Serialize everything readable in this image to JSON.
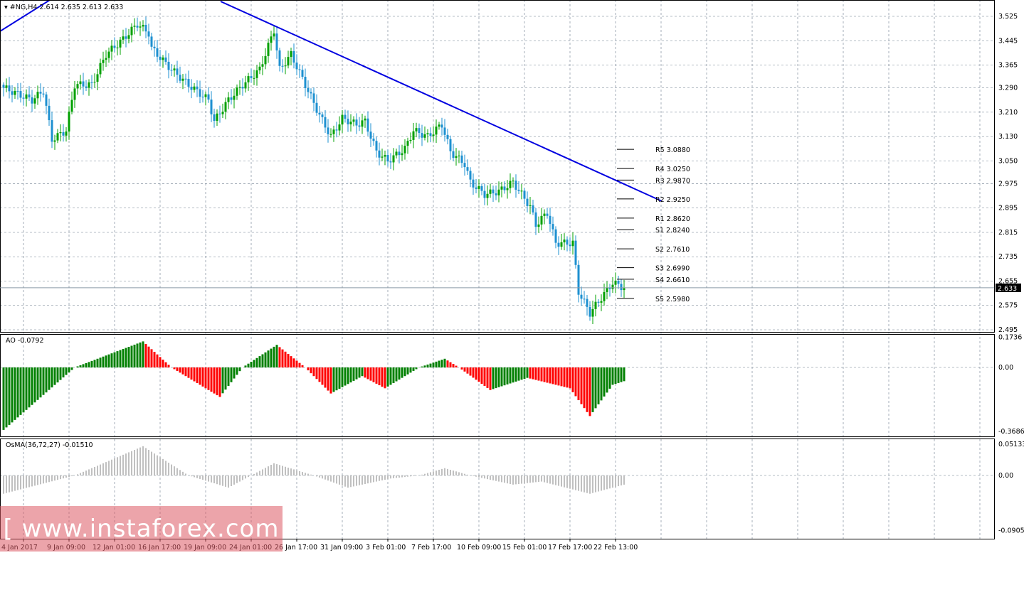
{
  "header": {
    "symbol": "#NG,H4",
    "ohlc": "2.614 2.635 2.613 2.633"
  },
  "watermark": "[ www.instaforex.com ]",
  "colors": {
    "up": "#00a000",
    "down": "#1e90d0",
    "trend": "#0000e0",
    "ao_up": "#008000",
    "ao_down": "#ff0000",
    "osma": "#c0c0c0",
    "grid": "#6a7a8a"
  },
  "chart_data": [
    {
      "type": "candlestick",
      "title": "#NG,H4",
      "last_price": "2.633",
      "yticks": [
        "3.525",
        "3.445",
        "3.365",
        "3.290",
        "3.210",
        "3.130",
        "3.050",
        "2.975",
        "2.895",
        "2.815",
        "2.735",
        "2.655",
        "2.575",
        "2.495"
      ],
      "ylim": [
        2.495,
        3.525
      ],
      "xticks": [
        "4 Jan 2017",
        "9 Jan 09:00",
        "12 Jan 01:00",
        "16 Jan 17:00",
        "19 Jan 09:00",
        "24 Jan 01:00",
        "26 Jan 17:00",
        "31 Jan 09:00",
        "3 Feb 01:00",
        "7 Feb 17:00",
        "10 Feb 09:00",
        "15 Feb 01:00",
        "17 Feb 17:00",
        "22 Feb 13:00"
      ],
      "close_keypoints": [
        [
          0,
          3.29
        ],
        [
          10,
          3.25
        ],
        [
          14,
          3.28
        ],
        [
          17,
          3.12
        ],
        [
          22,
          3.15
        ],
        [
          25,
          3.3
        ],
        [
          31,
          3.3
        ],
        [
          36,
          3.4
        ],
        [
          42,
          3.45
        ],
        [
          47,
          3.5
        ],
        [
          51,
          3.47
        ],
        [
          52,
          3.42
        ],
        [
          59,
          3.35
        ],
        [
          65,
          3.3
        ],
        [
          72,
          3.25
        ],
        [
          74,
          3.18
        ],
        [
          79,
          3.25
        ],
        [
          84,
          3.3
        ],
        [
          90,
          3.35
        ],
        [
          95,
          3.48
        ],
        [
          97,
          3.35
        ],
        [
          101,
          3.4
        ],
        [
          106,
          3.3
        ],
        [
          111,
          3.2
        ],
        [
          115,
          3.13
        ],
        [
          119,
          3.19
        ],
        [
          124,
          3.17
        ],
        [
          127,
          3.18
        ],
        [
          131,
          3.08
        ],
        [
          135,
          3.05
        ],
        [
          141,
          3.09
        ],
        [
          144,
          3.15
        ],
        [
          149,
          3.13
        ],
        [
          154,
          3.17
        ],
        [
          157,
          3.08
        ],
        [
          162,
          3.04
        ],
        [
          164,
          2.98
        ],
        [
          169,
          2.94
        ],
        [
          174,
          2.95
        ],
        [
          179,
          2.98
        ],
        [
          185,
          2.9
        ],
        [
          187,
          2.84
        ],
        [
          191,
          2.88
        ],
        [
          194,
          2.78
        ],
        [
          200,
          2.78
        ],
        [
          202,
          2.62
        ],
        [
          206,
          2.55
        ],
        [
          210,
          2.6
        ],
        [
          214,
          2.65
        ],
        [
          218,
          2.633
        ]
      ],
      "pivots": [
        {
          "label": "R5",
          "value": "3.0880"
        },
        {
          "label": "R4",
          "value": "3.0250"
        },
        {
          "label": "R3",
          "value": "2.9870"
        },
        {
          "label": "R2",
          "value": "2.9250"
        },
        {
          "label": "R1",
          "value": "2.8620"
        },
        {
          "label": "S1",
          "value": "2.8240"
        },
        {
          "label": "S2",
          "value": "2.7610"
        },
        {
          "label": "S3",
          "value": "2.6990"
        },
        {
          "label": "S4",
          "value": "2.6610"
        },
        {
          "label": "S5",
          "value": "2.5980"
        }
      ]
    },
    {
      "type": "bar",
      "title": "AO -0.0792",
      "yticks": [
        "0.1736",
        "0.00",
        "-0.3686"
      ],
      "ylim": [
        -0.3686,
        0.1736
      ],
      "keypoints": [
        [
          0,
          -0.36
        ],
        [
          25,
          0
        ],
        [
          49,
          0.15
        ],
        [
          59,
          0
        ],
        [
          76,
          -0.17
        ],
        [
          84,
          0
        ],
        [
          96,
          0.13
        ],
        [
          106,
          0
        ],
        [
          115,
          -0.15
        ],
        [
          126,
          -0.05
        ],
        [
          134,
          -0.12
        ],
        [
          146,
          0
        ],
        [
          155,
          0.05
        ],
        [
          160,
          0
        ],
        [
          171,
          -0.13
        ],
        [
          184,
          -0.06
        ],
        [
          199,
          -0.12
        ],
        [
          206,
          -0.28
        ],
        [
          214,
          -0.1
        ],
        [
          218,
          -0.0792
        ]
      ]
    },
    {
      "type": "bar",
      "title": "OsMA(36,72,27) -0.01510",
      "yticks": [
        "0.05133",
        "0.00",
        "-0.0905"
      ],
      "ylim": [
        -0.0905,
        0.05133
      ],
      "keypoints": [
        [
          0,
          -0.03
        ],
        [
          25,
          0
        ],
        [
          49,
          0.048
        ],
        [
          65,
          0
        ],
        [
          79,
          -0.02
        ],
        [
          95,
          0.02
        ],
        [
          109,
          0
        ],
        [
          121,
          -0.02
        ],
        [
          136,
          -0.005
        ],
        [
          146,
          0
        ],
        [
          155,
          0.012
        ],
        [
          164,
          0
        ],
        [
          179,
          -0.015
        ],
        [
          189,
          -0.01
        ],
        [
          206,
          -0.03
        ],
        [
          218,
          -0.0151
        ]
      ]
    }
  ]
}
